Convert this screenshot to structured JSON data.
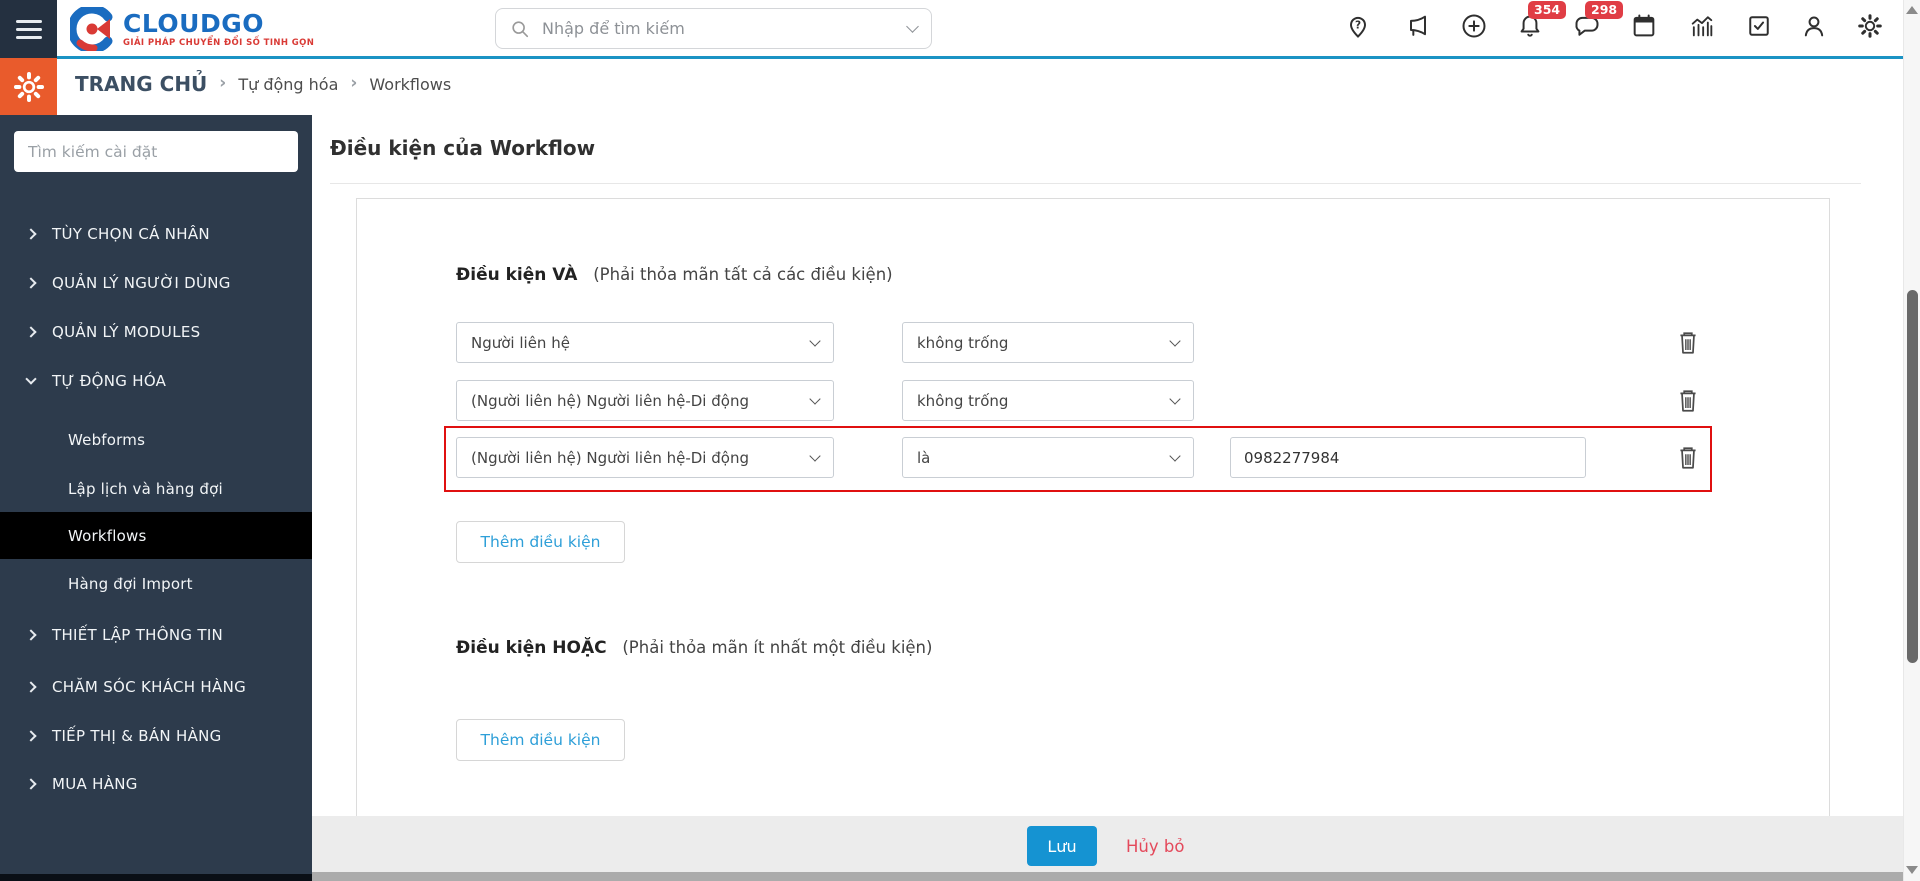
{
  "topbar": {
    "logo": {
      "title": "CLOUDGO",
      "tagline": "GIẢI PHÁP CHUYỂN ĐỔI SỐ TINH GỌN"
    },
    "search_placeholder": "Nhập để tìm kiếm",
    "badges": {
      "notifications": "354",
      "messages": "298"
    },
    "icons": [
      "location-help",
      "announcement",
      "add",
      "notifications",
      "messages",
      "calendar",
      "analytics",
      "tasks",
      "profile",
      "settings"
    ]
  },
  "breadcrumb": {
    "root": "TRANG CHỦ",
    "sep": "›",
    "item1": "Tự động hóa",
    "item2": "Workflows"
  },
  "sidebar": {
    "search_placeholder": "Tìm kiếm cài đặt",
    "groups": [
      {
        "label": "TÙY CHỌN CÁ NHÂN"
      },
      {
        "label": "QUẢN LÝ NGƯỜI DÙNG"
      },
      {
        "label": "QUẢN LÝ MODULES"
      },
      {
        "label": "TỰ ĐỘNG HÓA"
      },
      {
        "label": "THIẾT LẬP THÔNG TIN"
      },
      {
        "label": "CHĂM SÓC KHÁCH HÀNG"
      },
      {
        "label": "TIẾP THỊ & BÁN HÀNG"
      },
      {
        "label": "MUA HÀNG"
      }
    ],
    "automation_children": [
      {
        "label": "Webforms",
        "active": false
      },
      {
        "label": "Lập lịch và hàng đợi",
        "active": false
      },
      {
        "label": "Workflows",
        "active": true
      },
      {
        "label": "Hàng đợi Import",
        "active": false
      }
    ]
  },
  "main": {
    "title": "Điều kiện của Workflow",
    "and_section": {
      "title": "Điều kiện VÀ",
      "hint": "(Phải thỏa mãn tất cả các điều kiện)",
      "rows": [
        {
          "field": "Người liên hệ",
          "operator": "không trống",
          "value": "",
          "highlighted": false
        },
        {
          "field": "(Người liên hệ) Người liên hệ-Di động",
          "operator": "không trống",
          "value": "",
          "highlighted": false
        },
        {
          "field": "(Người liên hệ) Người liên hệ-Di động",
          "operator": "là",
          "value": "0982277984",
          "highlighted": true
        }
      ],
      "add_button": "Thêm điều kiện"
    },
    "or_section": {
      "title": "Điều kiện HOẶC",
      "hint": "(Phải thỏa mãn ít nhất một điều kiện)",
      "add_button": "Thêm điều kiện"
    }
  },
  "footer": {
    "save": "Lưu",
    "cancel": "Hủy bỏ"
  },
  "colors": {
    "accent_teal": "#1b93c4",
    "sidebar_navy": "#2d3b4c",
    "active_item": "#000000",
    "orange_tile": "#e95b2c",
    "badge_red": "#e03d45",
    "highlight_red": "#e01010",
    "save_blue": "#1593d2",
    "cancel_red": "#e4495b",
    "link_blue": "#2e9fd8"
  }
}
